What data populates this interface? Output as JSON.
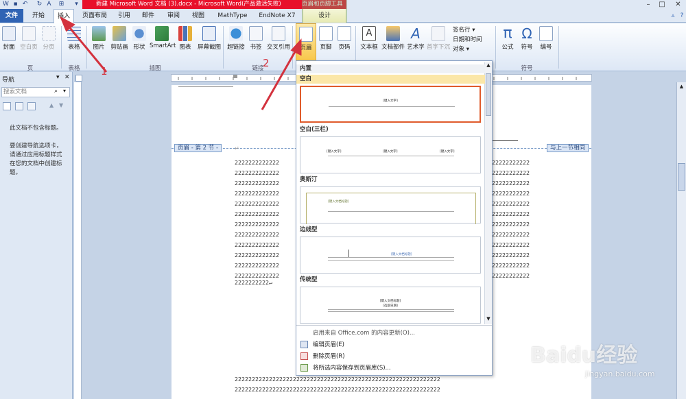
{
  "window": {
    "title": "新建 Microsoft Word 文档 (3).docx - Microsoft Word(产品激活失败)",
    "context_title": "页眉和页脚工具"
  },
  "tabs": [
    "文件",
    "开始",
    "插入",
    "页面布局",
    "引用",
    "邮件",
    "审阅",
    "视图",
    "MathType",
    "EndNote X7",
    "设计"
  ],
  "ribbon": {
    "pages": {
      "label": "页",
      "buttons": [
        "封面",
        "空白页",
        "分页"
      ]
    },
    "tables": {
      "label": "表格",
      "buttons": [
        "表格"
      ]
    },
    "illustrations": {
      "label": "插图",
      "buttons": [
        "图片",
        "剪贴画",
        "形状",
        "SmartArt",
        "图表",
        "屏幕截图"
      ]
    },
    "links": {
      "label": "链接",
      "buttons": [
        "超链接",
        "书签",
        "交叉引用"
      ]
    },
    "header_footer": {
      "buttons": [
        "页眉",
        "页脚",
        "页码"
      ]
    },
    "text": {
      "buttons": [
        "文本框",
        "文档部件",
        "艺术字",
        "首字下沉"
      ],
      "small": [
        "签名行 ▾",
        "日期和时间",
        "对象 ▾"
      ]
    },
    "symbols": {
      "label": "符号",
      "buttons": [
        "公式",
        "符号",
        "编号"
      ]
    }
  },
  "nav": {
    "title": "导航",
    "search_placeholder": "搜索文档",
    "message_1": "此文档不包含标题。",
    "message_2": "要创建导航选项卡，请通过应用标题样式在您的文档中创建标题。"
  },
  "document": {
    "header_badge": "页眉 - 第 2 节 -",
    "same_as_prev": "与上一节相同",
    "para_mark": "↵",
    "row_text_left": "2222222222222",
    "row_text_right": "22222222222",
    "last_line": "2222222222↵",
    "full_row": "222222222222222222222222222222222222222222222222222222222222"
  },
  "gallery": {
    "builtin": "内置",
    "items": [
      {
        "name": "空白",
        "placeholder": "[键入文字]"
      },
      {
        "name": "空白(三栏)",
        "placeholder": "[键入文字]"
      },
      {
        "name": "奥斯汀",
        "placeholder": "[键入文档标题]"
      },
      {
        "name": "边线型",
        "placeholder": "[键入文档标题]"
      },
      {
        "name": "传统型",
        "placeholder": "[键入文档标题]",
        "placeholder2": "[选取日期]"
      }
    ],
    "menu": [
      "启用来自 Office.com 的内容更新(O)...",
      "编辑页眉(E)",
      "删除页眉(R)",
      "将所选内容保存到页眉库(S)..."
    ]
  },
  "annotations": {
    "step1": "1",
    "step2": "2",
    "color": "#d3323e"
  },
  "watermark": {
    "brand": "Baidu经验",
    "url": "jingyan.baidu.com"
  }
}
